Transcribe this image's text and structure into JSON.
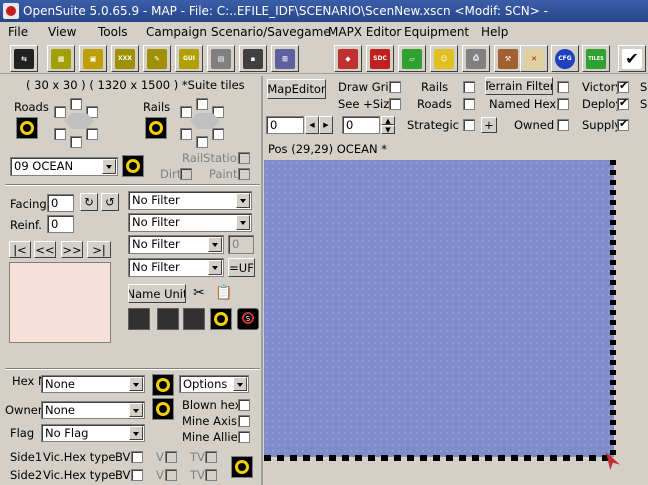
{
  "title": "OpenSuite  5.0.65.9 - MAP - File: C:..EFILE_IDF\\SCENARIO\\ScenNew.xscn <Modif: SCN>  -",
  "menu": [
    "File",
    "View",
    "Tools",
    "Campaign",
    "Scenario/Savegame",
    "MAPX Editor",
    "Equipment",
    "Help"
  ],
  "toolbar_icons": [
    "map-icon",
    "grid-icon",
    "frame-icon",
    "xxx-icon",
    "edit-icon",
    "gui-icon",
    "save-icon",
    "save-as-icon",
    "eraser-icon",
    "sdc-icon",
    "sheet-icon",
    "paint-icon",
    "unit-face-icon",
    "print-icon",
    "pick-icon",
    "no-tool-icon",
    "cfg-icon",
    "tiles-icon",
    "confirm-icon"
  ],
  "toolbar_text": {
    "gui": "GUI",
    "sdc": "SDC",
    "cfg": "CFG",
    "tiles": "TILES",
    "xxx": "XXX"
  },
  "left": {
    "map_info": "( 30 x 30 )  ( 1320 x 1500 ) *Suite tiles",
    "roads_label": "Roads",
    "rails_label": "Rails",
    "terrain_select": "09 OCEAN",
    "railstation_label": "RailStation",
    "dirt_label": "Dirt",
    "paint_label": "Paint",
    "facing_label": "Facing",
    "facing_value": "0",
    "reinf_label": "Reinf.",
    "reinf_value": "0",
    "nav": [
      "|<",
      "<<",
      ">>",
      ">|"
    ],
    "filters": [
      "No Filter",
      "No Filter",
      "No Filter",
      "No Filter"
    ],
    "filter_num": "0",
    "uf_button": "=UF",
    "name_unit_button": "Name Unit",
    "hexname_label": "Hex Name",
    "hexname_value": "None",
    "owner_label": "Owner",
    "owner_value": "None",
    "options_value": "Options",
    "blown_hex": "Blown hex",
    "mine_axis": "Mine Axis",
    "mine_allied": "Mine Allied",
    "flag_label": "Flag",
    "flag_value": "No Flag",
    "side1": "Side1",
    "side2": "Side2",
    "vic_hex_type": "Vic.Hex type",
    "bv": "BV",
    "v": "V",
    "tv": "TV"
  },
  "top": {
    "map_editor_button": "MapEditor",
    "draw_grid": "Draw Grid",
    "see_size": "See +Size",
    "rails": "Rails",
    "roads": "Roads",
    "terrain_filter_button": "Terrain Filter",
    "named_hex": "Named Hex",
    "victory": "Victory",
    "deploy": "Deploy",
    "s1": "S",
    "s2": "S",
    "spin1": "0",
    "spin2": "0",
    "strategic": "Strategic V.",
    "plus": "+",
    "owned": "Owned",
    "supply": "Supply"
  },
  "status": "Pos (29,29)  OCEAN  *"
}
